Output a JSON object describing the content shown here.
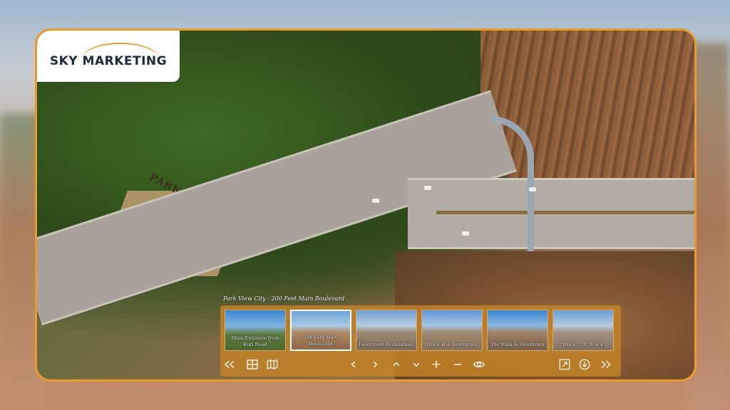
{
  "brand": {
    "logo_text": "SKY MARKETING",
    "accent": "#e79a2e"
  },
  "tour": {
    "current_title": "Park View City - 200 Feet Main Boulevard",
    "scene_sign_text": "PARK VIEW CITY",
    "thumbnails": [
      {
        "label": "Main Entrance from Kuri Road",
        "active": false
      },
      {
        "label": "200 Feet Main Boulevard",
        "active": true
      },
      {
        "label": "Downtown Roundabout",
        "active": false
      },
      {
        "label": "Block H & Downtown",
        "active": false
      },
      {
        "label": "The Walk & Downtown",
        "active": false
      },
      {
        "label": "Block C, D, E & F",
        "active": false
      }
    ]
  },
  "controls": {
    "left": [
      "rewind-icon",
      "thumbnails-grid-icon",
      "map-icon"
    ],
    "center": [
      "arrow-left-icon",
      "arrow-right-icon",
      "arrow-up-icon",
      "arrow-down-icon",
      "zoom-in-icon",
      "zoom-out-icon",
      "view-mode-icon"
    ],
    "right": [
      "fullscreen-icon",
      "download-icon",
      "fast-forward-icon"
    ]
  },
  "colors": {
    "panel": "#c48426",
    "frame": "#e79a2e",
    "icon": "#ffffff"
  }
}
